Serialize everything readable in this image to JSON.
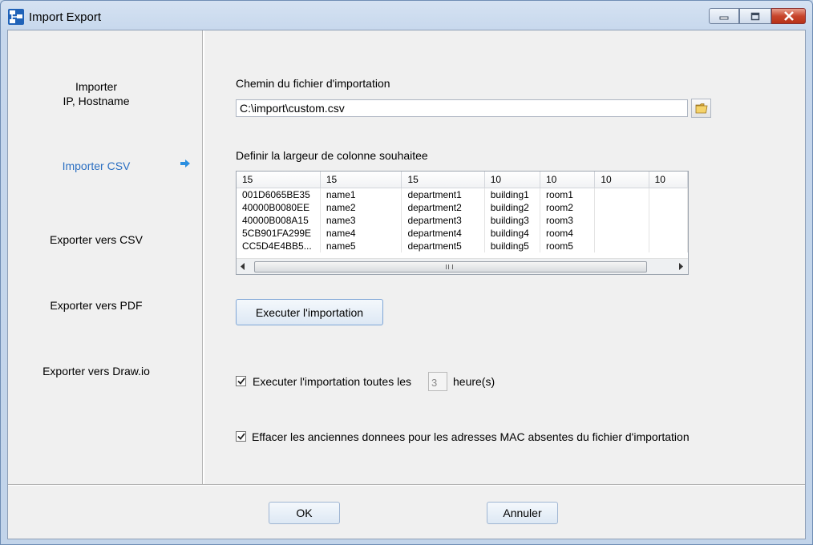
{
  "window": {
    "title": "Import Export",
    "icon": "app-network-icon",
    "controls": [
      "minimize-icon",
      "maximize-icon",
      "close-icon"
    ]
  },
  "sidebar": {
    "items": [
      {
        "label_line1": "Importer",
        "label_line2": "IP, Hostname"
      },
      {
        "label": "Importer CSV",
        "active": true
      },
      {
        "label": "Exporter vers CSV"
      },
      {
        "label": "Exporter vers PDF"
      },
      {
        "label": "Exporter vers Draw.io"
      }
    ],
    "active_color": "#2b6fc2",
    "active_marker": "arrow-right-icon"
  },
  "import": {
    "path_label": "Chemin du fichier d'importation",
    "path_value": "C:\\import\\custom.csv",
    "browse_icon": "folder-icon",
    "width_label": "Definir la largeur de colonne souhaitee",
    "columns": [
      "15",
      "15",
      "15",
      "10",
      "10",
      "10",
      "10"
    ],
    "rows": [
      [
        "001D6065BE35",
        "name1",
        "department1",
        "building1",
        "room1",
        "",
        ""
      ],
      [
        "40000B0080EE",
        "name2",
        "department2",
        "building2",
        "room2",
        "",
        ""
      ],
      [
        "40000B008A15",
        "name3",
        "department3",
        "building3",
        "room3",
        "",
        ""
      ],
      [
        "5CB901FA299E",
        "name4",
        "department4",
        "building4",
        "room4",
        "",
        ""
      ],
      [
        "CC5D4E4BB5...",
        "name5",
        "department5",
        "building5",
        "room5",
        "",
        ""
      ]
    ],
    "run_button": "Executer l'importation",
    "schedule_checked": true,
    "schedule_label": "Executer l'importation toutes les",
    "schedule_hours": "3",
    "schedule_unit": "heure(s)",
    "purge_checked": true,
    "purge_label": "Effacer les anciennes donnees pour les adresses MAC absentes du fichier d'importation"
  },
  "footer": {
    "ok": "OK",
    "cancel": "Annuler"
  }
}
